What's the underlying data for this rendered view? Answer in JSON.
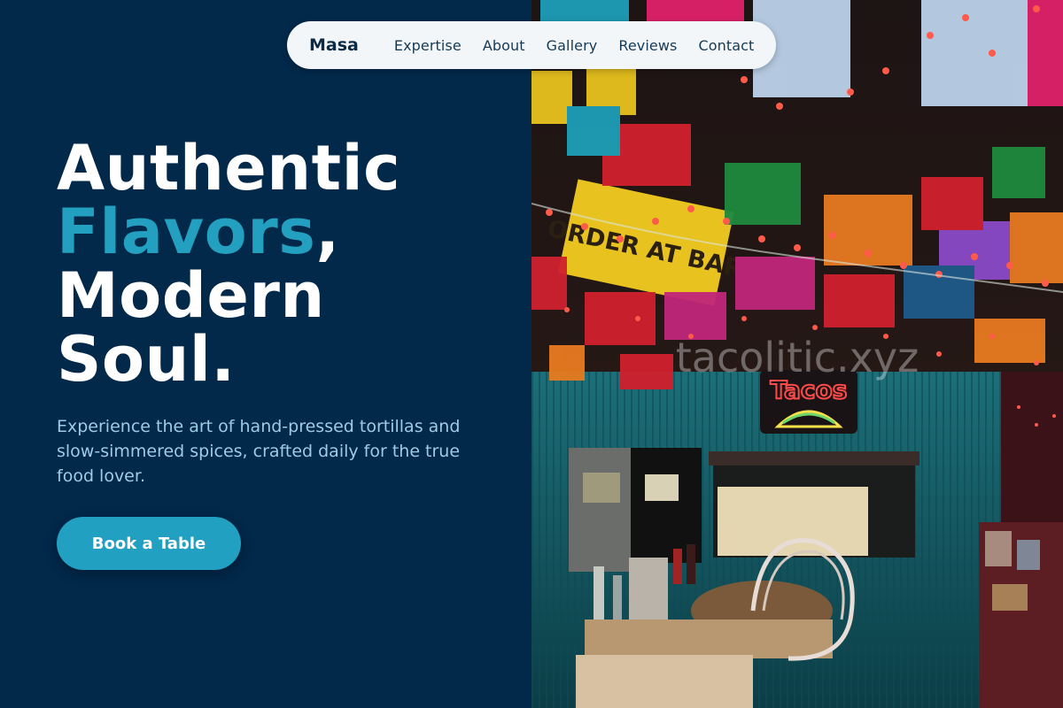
{
  "nav": {
    "brand": "Masa",
    "links": [
      "Expertise",
      "About",
      "Gallery",
      "Reviews",
      "Contact"
    ]
  },
  "hero": {
    "line1": "Authentic",
    "accent": "Flavors",
    "comma": ",",
    "line3": "Modern",
    "line4": "Soul.",
    "subtitle": "Experience the art of hand-pressed tortillas and slow-simmered spices, crafted daily for the true food lover.",
    "cta_label": "Book a Table"
  },
  "photo": {
    "sign_text": "ORDER AT BAR",
    "neon_text": "Tacos",
    "watermark": "tacolitic.xyz"
  },
  "colors": {
    "panel": "#02284a",
    "accent": "#23a0c0",
    "subtitle": "#9fcbe4",
    "button": "#22a0c2"
  }
}
